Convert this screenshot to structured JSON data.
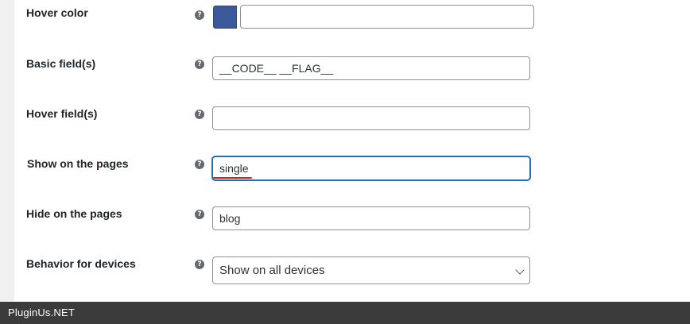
{
  "settings": {
    "hover_color": {
      "label": "Hover color",
      "swatch_color": "#3b5998",
      "value": "",
      "help_icon": "question-mark-icon"
    },
    "basic_fields": {
      "label": "Basic field(s)",
      "value": "__CODE__ __FLAG__",
      "help_icon": "question-mark-icon"
    },
    "hover_fields": {
      "label": "Hover field(s)",
      "value": "",
      "help_icon": "question-mark-icon"
    },
    "show_on_pages": {
      "label": "Show on the pages",
      "value": "single",
      "help_icon": "question-mark-icon"
    },
    "hide_on_pages": {
      "label": "Hide on the pages",
      "value": "blog",
      "help_icon": "question-mark-icon"
    },
    "behavior_for_devices": {
      "label": "Behavior for devices",
      "selected": "Show on all devices",
      "help_icon": "question-mark-icon",
      "dropdown_icon": "chevron-down-icon"
    }
  },
  "help_glyph": "?",
  "colors": {
    "accent_focus": "#2271b1",
    "spellcheck_underline": "#c9252b",
    "footer_background": "#3b3b3b"
  },
  "footer": {
    "brand": "PluginUs.NET"
  }
}
